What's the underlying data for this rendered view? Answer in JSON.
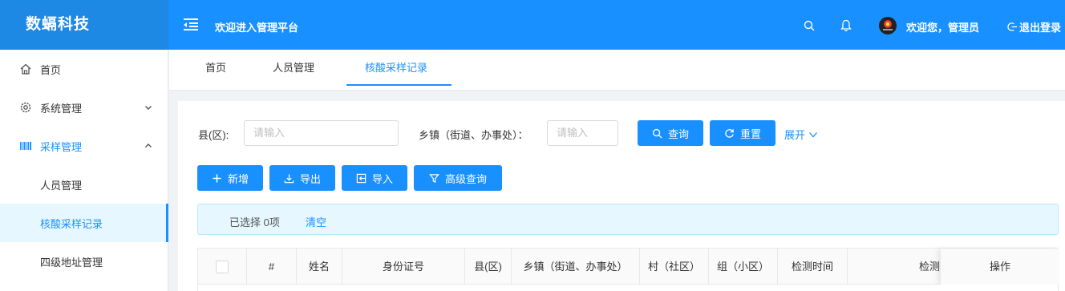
{
  "header": {
    "logo": "数螎科技",
    "title": "欢迎进入管理平台",
    "user_greeting": "欢迎您，管理员",
    "logout": "退出登录",
    "colors": {
      "primary": "#1890ff",
      "logo_bg": "#1e88e5"
    }
  },
  "sidebar": {
    "items": [
      {
        "label": "首页",
        "icon": "home-icon"
      },
      {
        "label": "系统管理",
        "icon": "gear-icon"
      },
      {
        "label": "采样管理",
        "icon": "barcode-icon"
      },
      {
        "label": "人员管理"
      },
      {
        "label": "核酸采样记录"
      },
      {
        "label": "四级地址管理"
      }
    ]
  },
  "tabs": [
    {
      "label": "首页"
    },
    {
      "label": "人员管理"
    },
    {
      "label": "核酸采样记录"
    }
  ],
  "filters": {
    "county_label": "县(区):",
    "county_placeholder": "请输入",
    "town_label": "乡镇（街道、办事处）：",
    "town_placeholder": "请输入",
    "search_btn": "查询",
    "reset_btn": "重置",
    "expand": "展开"
  },
  "toolbar": {
    "add": "新增",
    "export": "导出",
    "import": "导入",
    "advanced": "高级查询"
  },
  "selection": {
    "selected": "已选择 0项",
    "clear": "清空"
  },
  "table": {
    "columns": [
      "#",
      "姓名",
      "身份证号",
      "县(区)",
      "乡镇（街道、办事处）",
      "村（社区）",
      "组（小区）",
      "检测时间",
      "检测"
    ],
    "action_column": "操作"
  }
}
